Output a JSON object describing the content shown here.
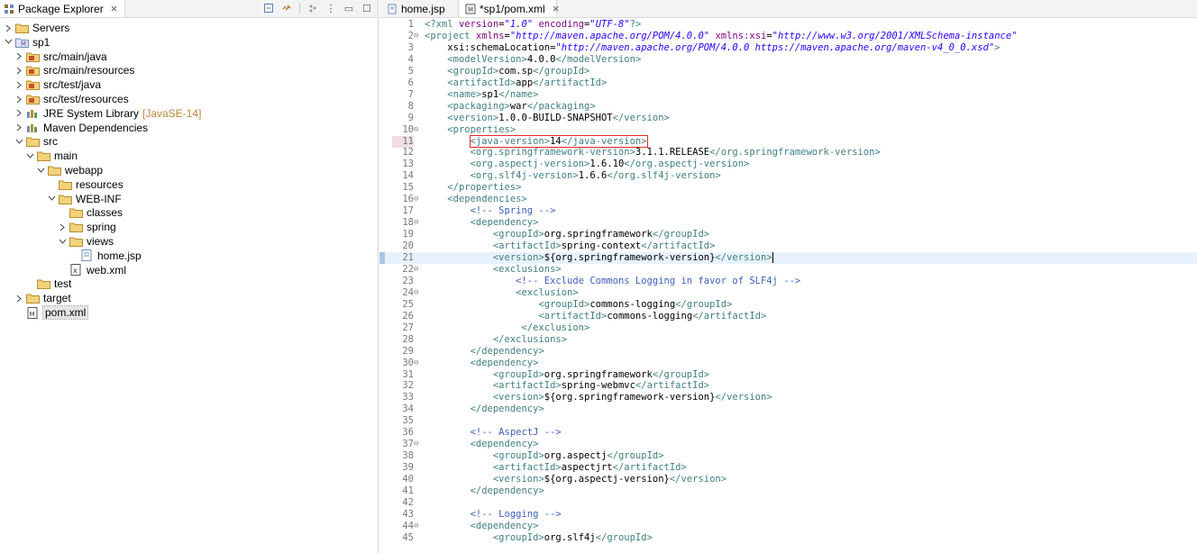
{
  "explorer": {
    "title": "Package Explorer",
    "tree": [
      {
        "label": "Servers",
        "icon": "folder-icon",
        "twisty": ">",
        "depth": 0
      },
      {
        "label": "sp1",
        "icon": "maven-project-icon",
        "twisty": "v",
        "depth": 0
      },
      {
        "label": "src/main/java",
        "icon": "source-folder-icon",
        "twisty": ">",
        "depth": 1
      },
      {
        "label": "src/main/resources",
        "icon": "source-folder-icon",
        "twisty": ">",
        "depth": 1
      },
      {
        "label": "src/test/java",
        "icon": "source-folder-icon",
        "twisty": ">",
        "depth": 1
      },
      {
        "label": "src/test/resources",
        "icon": "source-folder-icon",
        "twisty": ">",
        "depth": 1
      },
      {
        "label": "JRE System Library",
        "decoration": "[JavaSE-14]",
        "icon": "library-icon",
        "twisty": ">",
        "depth": 1
      },
      {
        "label": "Maven Dependencies",
        "icon": "library-icon",
        "twisty": ">",
        "depth": 1
      },
      {
        "label": "src",
        "icon": "folder-icon",
        "twisty": "v",
        "depth": 1
      },
      {
        "label": "main",
        "icon": "folder-icon",
        "twisty": "v",
        "depth": 2
      },
      {
        "label": "webapp",
        "icon": "folder-icon",
        "twisty": "v",
        "depth": 3
      },
      {
        "label": "resources",
        "icon": "folder-icon",
        "twisty": "",
        "depth": 4
      },
      {
        "label": "WEB-INF",
        "icon": "folder-icon",
        "twisty": "v",
        "depth": 4
      },
      {
        "label": "classes",
        "icon": "folder-icon",
        "twisty": "",
        "depth": 5
      },
      {
        "label": "spring",
        "icon": "folder-icon",
        "twisty": ">",
        "depth": 5
      },
      {
        "label": "views",
        "icon": "folder-icon",
        "twisty": "v",
        "depth": 5
      },
      {
        "label": "home.jsp",
        "icon": "jsp-file-icon",
        "twisty": "",
        "depth": 6
      },
      {
        "label": "web.xml",
        "icon": "xml-file-icon",
        "twisty": "",
        "depth": 5
      },
      {
        "label": "test",
        "icon": "folder-icon",
        "twisty": "",
        "depth": 2
      },
      {
        "label": "target",
        "icon": "folder-icon",
        "twisty": ">",
        "depth": 1
      },
      {
        "label": "pom.xml",
        "icon": "maven-file-icon",
        "twisty": "",
        "depth": 1,
        "selected": true
      }
    ]
  },
  "editor": {
    "tabs": [
      {
        "label": "home.jsp",
        "icon": "jsp-file-icon",
        "active": false
      },
      {
        "label": "*sp1/pom.xml",
        "icon": "maven-file-icon",
        "active": true
      }
    ],
    "current_line": 21,
    "highlighted_line": 11,
    "lines": [
      {
        "n": "1",
        "f": "",
        "t": "<?xml version=\"1.0\" encoding=\"UTF-8\"?>"
      },
      {
        "n": "2",
        "f": "⊖",
        "t": "<project xmlns=\"http://maven.apache.org/POM/4.0.0\" xmlns:xsi=\"http://www.w3.org/2001/XMLSchema-instance\""
      },
      {
        "n": "3",
        "f": "",
        "t": "    xsi:schemaLocation=\"http://maven.apache.org/POM/4.0.0 https://maven.apache.org/maven-v4_0_0.xsd\">"
      },
      {
        "n": "4",
        "f": "",
        "t": "    <modelVersion>4.0.0</modelVersion>"
      },
      {
        "n": "5",
        "f": "",
        "t": "    <groupId>com.sp</groupId>"
      },
      {
        "n": "6",
        "f": "",
        "t": "    <artifactId>app</artifactId>"
      },
      {
        "n": "7",
        "f": "",
        "t": "    <name>sp1</name>"
      },
      {
        "n": "8",
        "f": "",
        "t": "    <packaging>war</packaging>"
      },
      {
        "n": "9",
        "f": "",
        "t": "    <version>1.0.0-BUILD-SNAPSHOT</version>"
      },
      {
        "n": "10",
        "f": "⊖",
        "t": "    <properties>"
      },
      {
        "n": "11",
        "f": "",
        "t": "        <java-version>14</java-version>",
        "boxed": true
      },
      {
        "n": "12",
        "f": "",
        "t": "        <org.springframework-version>3.1.1.RELEASE</org.springframework-version>"
      },
      {
        "n": "13",
        "f": "",
        "t": "        <org.aspectj-version>1.6.10</org.aspectj-version>"
      },
      {
        "n": "14",
        "f": "",
        "t": "        <org.slf4j-version>1.6.6</org.slf4j-version>"
      },
      {
        "n": "15",
        "f": "",
        "t": "    </properties>"
      },
      {
        "n": "16",
        "f": "⊖",
        "t": "    <dependencies>"
      },
      {
        "n": "17",
        "f": "",
        "t": "        <!-- Spring -->"
      },
      {
        "n": "18",
        "f": "⊖",
        "t": "        <dependency>"
      },
      {
        "n": "19",
        "f": "",
        "t": "            <groupId>org.springframework</groupId>"
      },
      {
        "n": "20",
        "f": "",
        "t": "            <artifactId>spring-context</artifactId>"
      },
      {
        "n": "21",
        "f": "",
        "t": "            <version>${org.springframework-version}</version>",
        "caret": true
      },
      {
        "n": "22",
        "f": "⊖",
        "t": "            <exclusions>"
      },
      {
        "n": "23",
        "f": "",
        "t": "                <!-- Exclude Commons Logging in favor of SLF4j -->"
      },
      {
        "n": "24",
        "f": "⊖",
        "t": "                <exclusion>"
      },
      {
        "n": "25",
        "f": "",
        "t": "                    <groupId>commons-logging</groupId>"
      },
      {
        "n": "26",
        "f": "",
        "t": "                    <artifactId>commons-logging</artifactId>"
      },
      {
        "n": "27",
        "f": "",
        "t": "                 </exclusion>"
      },
      {
        "n": "28",
        "f": "",
        "t": "            </exclusions>"
      },
      {
        "n": "29",
        "f": "",
        "t": "        </dependency>"
      },
      {
        "n": "30",
        "f": "⊖",
        "t": "        <dependency>"
      },
      {
        "n": "31",
        "f": "",
        "t": "            <groupId>org.springframework</groupId>"
      },
      {
        "n": "32",
        "f": "",
        "t": "            <artifactId>spring-webmvc</artifactId>"
      },
      {
        "n": "33",
        "f": "",
        "t": "            <version>${org.springframework-version}</version>"
      },
      {
        "n": "34",
        "f": "",
        "t": "        </dependency>"
      },
      {
        "n": "35",
        "f": "",
        "t": ""
      },
      {
        "n": "36",
        "f": "",
        "t": "        <!-- AspectJ -->"
      },
      {
        "n": "37",
        "f": "⊖",
        "t": "        <dependency>"
      },
      {
        "n": "38",
        "f": "",
        "t": "            <groupId>org.aspectj</groupId>"
      },
      {
        "n": "39",
        "f": "",
        "t": "            <artifactId>aspectjrt</artifactId>"
      },
      {
        "n": "40",
        "f": "",
        "t": "            <version>${org.aspectj-version}</version>"
      },
      {
        "n": "41",
        "f": "",
        "t": "        </dependency>"
      },
      {
        "n": "42",
        "f": "",
        "t": ""
      },
      {
        "n": "43",
        "f": "",
        "t": "        <!-- Logging -->"
      },
      {
        "n": "44",
        "f": "⊖",
        "t": "        <dependency>"
      },
      {
        "n": "45",
        "f": "",
        "t": "            <groupId>org.slf4j</groupId>"
      }
    ]
  }
}
